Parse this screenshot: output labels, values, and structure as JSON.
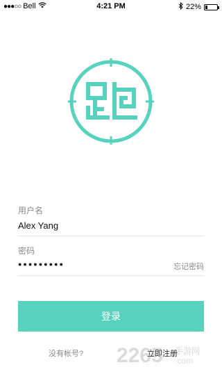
{
  "status_bar": {
    "carrier": "Bell",
    "time": "4:21 PM",
    "battery": "22%",
    "signal_dots": "●●●○○",
    "icons": [
      "wifi-icon",
      "bluetooth-icon",
      "battery-icon"
    ]
  },
  "logo": {
    "icon": "pao-logo",
    "colors": {
      "ring": "#57d2bf",
      "glyph": "#57d2bf"
    }
  },
  "form": {
    "username_label": "用户名",
    "username_value": "Alex  Yang",
    "password_label": "密码",
    "password_value": "●●●●●●●●●",
    "forgot_password": "忘记密码"
  },
  "login_button": "登录",
  "footer": {
    "no_account": "没有帐号?",
    "register": "立即注册"
  },
  "watermark": {
    "brand": "2265",
    "cn": "手游网",
    "domain": ".com"
  },
  "colors": {
    "accent": "#57d2bf",
    "muted_text": "#8a8a8a",
    "divider": "#e2e2e2"
  }
}
